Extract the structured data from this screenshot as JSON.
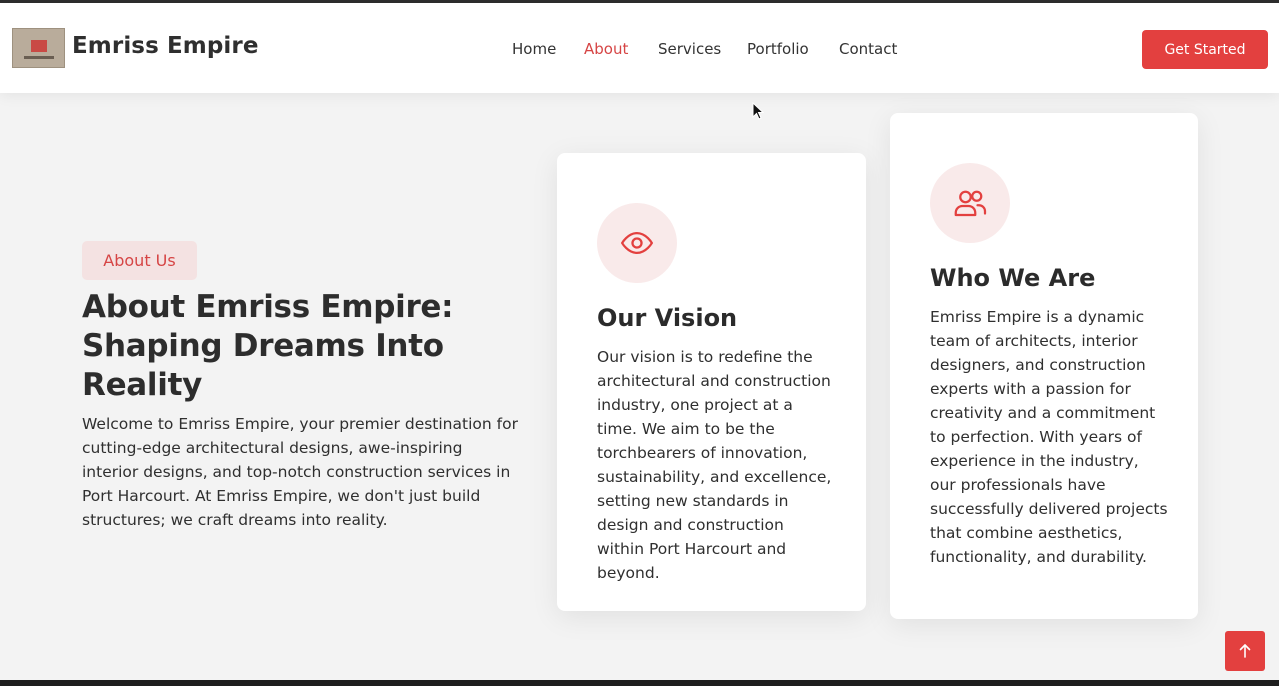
{
  "header": {
    "brand": "Emriss Empire",
    "nav": [
      {
        "label": "Home",
        "active": false
      },
      {
        "label": "About",
        "active": true
      },
      {
        "label": "Services",
        "active": false
      },
      {
        "label": "Portfolio",
        "active": false
      },
      {
        "label": "Contact",
        "active": false
      }
    ],
    "cta_label": "Get Started"
  },
  "about": {
    "pill": "About Us",
    "heading": "About Emriss Empire: Shaping Dreams Into Reality",
    "intro": "Welcome to Emriss Empire, your premier destination for cutting-edge architectural designs, awe-inspiring interior designs, and top-notch construction services in Port Harcourt. At Emriss Empire, we don't just build structures; we craft dreams into reality."
  },
  "cards": [
    {
      "icon": "eye-icon",
      "title": "Our Vision",
      "text": "Our vision is to redefine the architectural and construction industry, one project at a time. We aim to be the torchbearers of innovation, sustainability, and excellence, setting new standards in design and construction within Port Harcourt and beyond."
    },
    {
      "icon": "users-icon",
      "title": "Who We Are",
      "text": "Emriss Empire is a dynamic team of architects, interior designers, and construction experts with a passion for creativity and a commitment to perfection. With years of experience in the industry, our professionals have successfully delivered projects that combine aesthetics, functionality, and durability."
    }
  ],
  "colors": {
    "accent": "#e3403f",
    "active_nav": "#d64545",
    "pill_bg": "#f4e2e2",
    "page_bg": "#f3f3f3"
  }
}
